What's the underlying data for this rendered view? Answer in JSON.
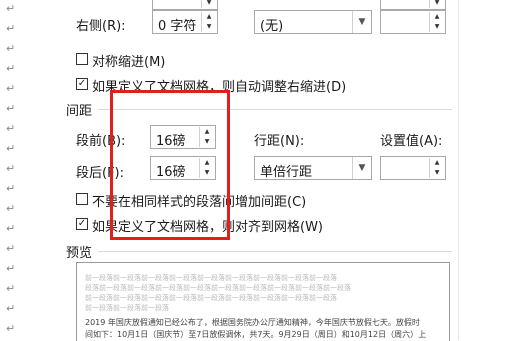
{
  "indent": {
    "right_label": "右侧(R):",
    "right_value": "0 字符",
    "special_value": "(无)",
    "mirror_label": "对称缩进(M)",
    "mirror_checked": false,
    "auto_adjust_label": "如果定义了文档网格，则自动调整右缩进(D)",
    "auto_adjust_checked": true
  },
  "spacing": {
    "section_title": "间距",
    "before_label": "段前(B):",
    "before_value": "16磅",
    "after_label": "段后(F):",
    "after_value": "16磅",
    "line_spacing_label": "行距(N):",
    "line_spacing_value": "单倍行距",
    "set_value_label": "设置值(A):",
    "set_value": "",
    "no_space_label": "不要在相同样式的段落间增加间距(C)",
    "no_space_checked": false,
    "snap_grid_label": "如果定义了文档网格，则对齐到网格(W)",
    "snap_grid_checked": true
  },
  "preview": {
    "title": "预览",
    "ghost_line_1": "前一段落前一段落前一段落前一段落前一段落前一段落前一段落前一段落前一段落",
    "ghost_line_2": "段落前一段落前一段落前一段落前一段落前一段落前一段落前一段落前一段落前一段落",
    "ghost_line_3": "前一段落前一段落前一段落前一段落前一段落前一段落前一段落前一段落前一段落",
    "ghost_line_4": "前一段落前一段落前一段落",
    "text_line_1": "2019 年国庆放假通知已经公布了，根据国务院办公厅通知精神，今年国庆节放假七天。放假时",
    "text_line_2": "间如下：10月1日（国庆节）至7日放假调休，共7天。9月29日（周日）和10月12日（周六）上"
  },
  "doc": {
    "para_mark": "↵"
  }
}
